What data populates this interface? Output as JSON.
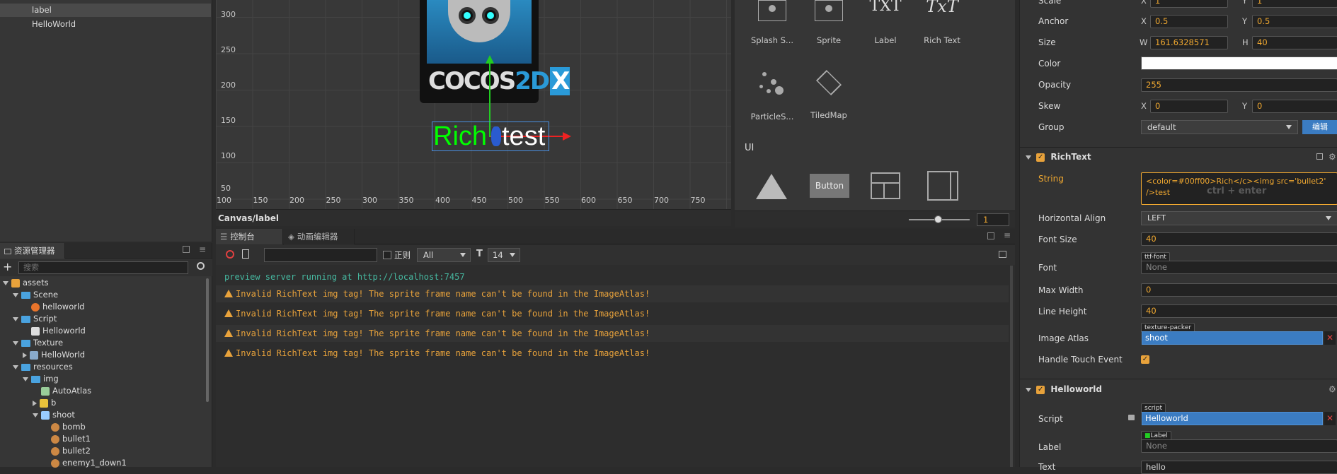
{
  "hierarchy": {
    "items": [
      "label",
      "HelloWorld"
    ]
  },
  "assets": {
    "tab_label": "资源管理器",
    "search_placeholder": "搜索",
    "tree": [
      {
        "label": "assets",
        "depth": 0,
        "kind": "root"
      },
      {
        "label": "Scene",
        "depth": 1,
        "kind": "folder"
      },
      {
        "label": "helloworld",
        "depth": 2,
        "kind": "scene"
      },
      {
        "label": "Script",
        "depth": 1,
        "kind": "folder"
      },
      {
        "label": "Helloworld",
        "depth": 2,
        "kind": "script"
      },
      {
        "label": "Texture",
        "depth": 1,
        "kind": "folder"
      },
      {
        "label": "HelloWorld",
        "depth": 2,
        "kind": "texture"
      },
      {
        "label": "resources",
        "depth": 1,
        "kind": "folder"
      },
      {
        "label": "img",
        "depth": 2,
        "kind": "folder"
      },
      {
        "label": "AutoAtlas",
        "depth": 3,
        "kind": "atlas"
      },
      {
        "label": "b",
        "depth": 3,
        "kind": "image"
      },
      {
        "label": "shoot",
        "depth": 3,
        "kind": "plist"
      },
      {
        "label": "bomb",
        "depth": 4,
        "kind": "sprite"
      },
      {
        "label": "bullet1",
        "depth": 4,
        "kind": "sprite"
      },
      {
        "label": "bullet2",
        "depth": 4,
        "kind": "sprite"
      },
      {
        "label": "enemy1_down1",
        "depth": 4,
        "kind": "sprite"
      }
    ]
  },
  "scene": {
    "y_ticks": [
      "300",
      "250",
      "200",
      "150",
      "100",
      "50"
    ],
    "x_ticks": [
      "100",
      "150",
      "200",
      "250",
      "300",
      "350",
      "400",
      "450",
      "500",
      "550",
      "600",
      "650",
      "700",
      "750"
    ],
    "breadcrumb": "Canvas/label",
    "logo_text": "COCOS",
    "logo_text2": "2D",
    "logo_text3": "X",
    "rich_green": "Rich",
    "rich_white": "test"
  },
  "widgets": {
    "items": [
      "Splash S...",
      "Sprite",
      "Label",
      "Rich Text",
      "ParticleS...",
      "TiledMap"
    ],
    "label_glyph": "TXT",
    "richtext_glyph": "TxT",
    "ui_header": "UI",
    "button_label": "Button",
    "zoom_value": "1"
  },
  "console": {
    "tab_console": "控制台",
    "tab_anim": "动画编辑器",
    "regex_label": "正则",
    "filter_value": "All",
    "font_size": "14",
    "lines": [
      {
        "text": "preview server running at http://localhost:7457",
        "type": "info"
      },
      {
        "text": "Invalid RichText img tag! The sprite frame name can't be found in the ImageAtlas!",
        "type": "warn"
      },
      {
        "text": "Invalid RichText img tag! The sprite frame name can't be found in the ImageAtlas!",
        "type": "warn"
      },
      {
        "text": "Invalid RichText img tag! The sprite frame name can't be found in the ImageAtlas!",
        "type": "warn"
      },
      {
        "text": "Invalid RichText img tag! The sprite frame name can't be found in the ImageAtlas!",
        "type": "warn"
      }
    ]
  },
  "inspector": {
    "scale": {
      "label": "Scale",
      "x": "1",
      "y": "1"
    },
    "anchor": {
      "label": "Anchor",
      "x": "0.5",
      "y": "0.5"
    },
    "size": {
      "label": "Size",
      "w": "161.6328571",
      "h": "40"
    },
    "color_label": "Color",
    "color_value": "#ffffff",
    "opacity": {
      "label": "Opacity",
      "value": "255"
    },
    "skew": {
      "label": "Skew",
      "x": "0",
      "y": "0"
    },
    "group": {
      "label": "Group",
      "value": "default",
      "edit": "编辑"
    },
    "axis": {
      "x": "X",
      "y": "Y",
      "w": "W",
      "h": "H"
    },
    "richtext": {
      "header": "RichText",
      "string_label": "String",
      "string_value": "<color=#00ff00>Rich</c><img src='bullet2' />test",
      "string_hint": "ctrl + enter",
      "halign_label": "Horizontal Align",
      "halign_value": "LEFT",
      "fontsize_label": "Font Size",
      "fontsize_value": "40",
      "font_label": "Font",
      "font_tag": "ttf-font",
      "font_value": "None",
      "maxwidth_label": "Max Width",
      "maxwidth_value": "0",
      "lineheight_label": "Line Height",
      "lineheight_value": "40",
      "atlas_label": "Image Atlas",
      "atlas_tag": "texture-packer",
      "atlas_value": "shoot",
      "touch_label": "Handle Touch Event"
    },
    "helloworld": {
      "header": "Helloworld",
      "script_label": "Script",
      "script_tag": "script",
      "script_value": "Helloworld",
      "label_label": "Label",
      "label_tag": "Label",
      "label_value": "None",
      "text_label": "Text",
      "text_value": "hello"
    }
  },
  "colors": {
    "accent": "#e8a23b",
    "selection": "#3b7cc2",
    "rich_green": "#00ff00",
    "info": "#46b8a0"
  }
}
